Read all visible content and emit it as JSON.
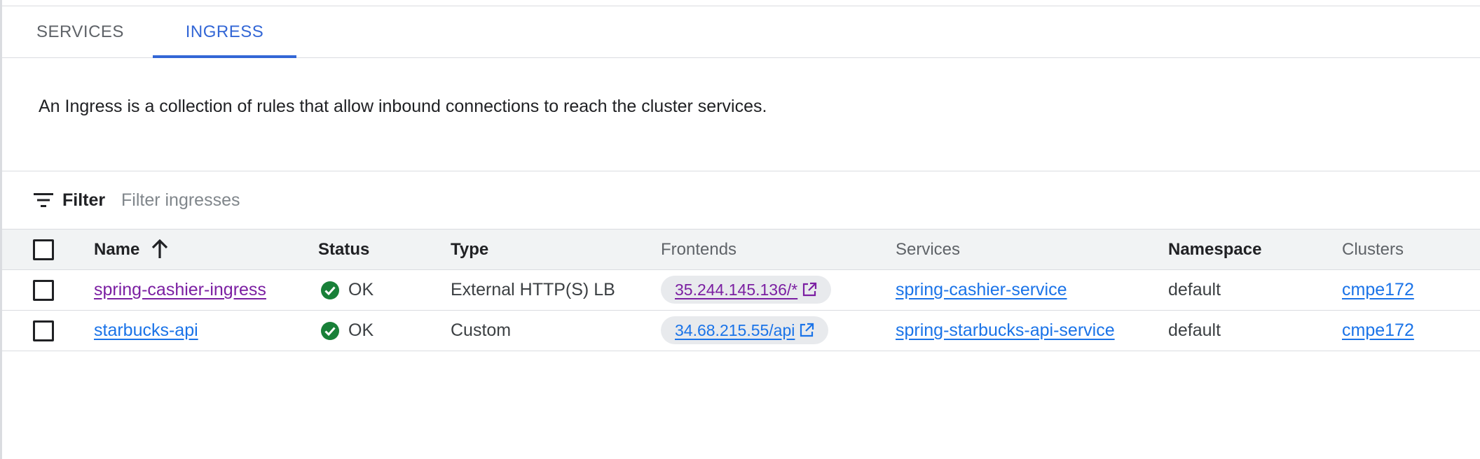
{
  "tabs": [
    {
      "label": "SERVICES",
      "active": false
    },
    {
      "label": "INGRESS",
      "active": true
    }
  ],
  "description": "An Ingress is a collection of rules that allow inbound connections to reach the cluster services.",
  "filter": {
    "label": "Filter",
    "placeholder": "Filter ingresses",
    "icon": "filter-list-icon"
  },
  "table": {
    "columns": {
      "name": "Name",
      "status": "Status",
      "type": "Type",
      "frontends": "Frontends",
      "services": "Services",
      "namespace": "Namespace",
      "clusters": "Clusters"
    },
    "sort": {
      "column": "name",
      "direction": "ascending",
      "icon": "arrow-upward-icon"
    },
    "rows": [
      {
        "name": "spring-cashier-ingress",
        "status": "OK",
        "type": "External HTTP(S) LB",
        "frontend": "35.244.145.136/*",
        "service": "spring-cashier-service",
        "namespace": "default",
        "cluster": "cmpe172"
      },
      {
        "name": "starbucks-api",
        "status": "OK",
        "type": "Custom",
        "frontend": "34.68.215.55/api",
        "service": "spring-starbucks-api-service",
        "namespace": "default",
        "cluster": "cmpe172"
      }
    ]
  },
  "colors": {
    "accent": "#3367d6",
    "link": "#1a73e8",
    "visited_link": "#7b1fa2",
    "status_ok": "#188038",
    "header_bg": "#f1f3f4",
    "divider": "#dadce0"
  }
}
